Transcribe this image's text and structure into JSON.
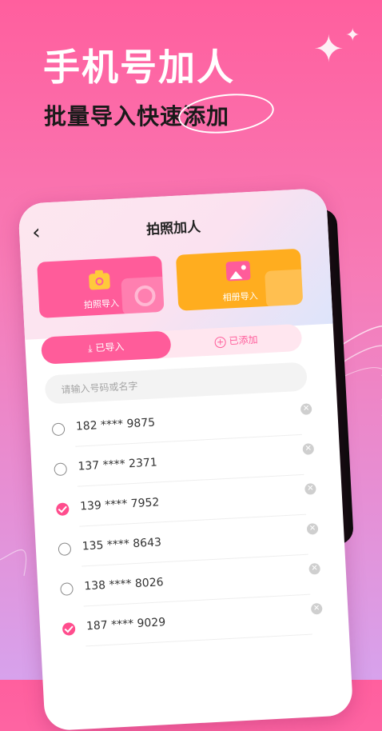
{
  "headline": "手机号加人",
  "subline_prefix": "批量导入快速",
  "subline_highlight": "添加",
  "phone": {
    "title": "拍照加人",
    "back_icon": "chevron-left-icon",
    "cards": [
      {
        "label": "拍照导入",
        "icon": "camera-icon",
        "color": "#ff5c9a"
      },
      {
        "label": "相册导入",
        "icon": "picture-icon",
        "color": "#ffad1f"
      }
    ],
    "tabs": [
      {
        "label": "已导入",
        "icon": "import-icon",
        "active": true
      },
      {
        "label": "已添加",
        "icon": "plus-circle-icon",
        "active": false
      }
    ],
    "search_placeholder": "请输入号码或名字",
    "contacts": [
      {
        "number": "182 **** 9875",
        "checked": false
      },
      {
        "number": "137 **** 2371",
        "checked": false
      },
      {
        "number": "139 **** 7952",
        "checked": true
      },
      {
        "number": "135 **** 8643",
        "checked": false
      },
      {
        "number": "138 **** 8026",
        "checked": false
      },
      {
        "number": "187 **** 9029",
        "checked": true
      }
    ]
  },
  "colors": {
    "accent": "#ff5c9a",
    "orange": "#ffad1f",
    "check": "#ff4d8d"
  }
}
